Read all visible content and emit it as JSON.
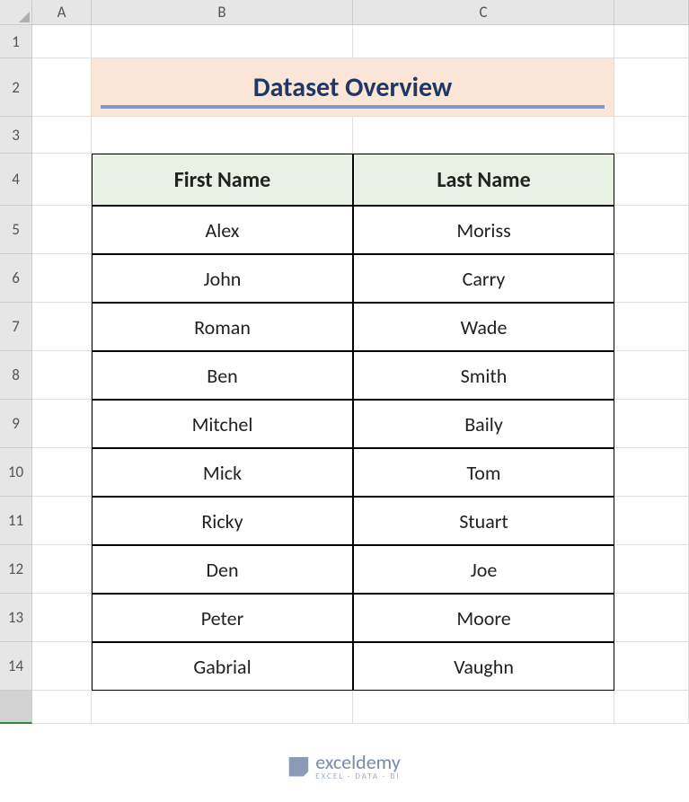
{
  "columns": [
    "A",
    "B",
    "C"
  ],
  "rows": [
    "1",
    "2",
    "3",
    "4",
    "5",
    "6",
    "7",
    "8",
    "9",
    "10",
    "11",
    "12",
    "13",
    "14"
  ],
  "title": "Dataset Overview",
  "headers": {
    "first": "First Name",
    "last": "Last Name"
  },
  "data": [
    {
      "first": "Alex",
      "last": "Moriss"
    },
    {
      "first": "John",
      "last": "Carry"
    },
    {
      "first": "Roman",
      "last": "Wade"
    },
    {
      "first": "Ben",
      "last": "Smith"
    },
    {
      "first": "Mitchel",
      "last": "Baily"
    },
    {
      "first": "Mick",
      "last": "Tom"
    },
    {
      "first": "Ricky",
      "last": "Stuart"
    },
    {
      "first": "Den",
      "last": "Joe"
    },
    {
      "first": "Peter",
      "last": "Moore"
    },
    {
      "first": "Gabrial",
      "last": "Vaughn"
    }
  ],
  "watermark": {
    "brand": "exceldemy",
    "tag": "EXCEL · DATA · BI"
  }
}
